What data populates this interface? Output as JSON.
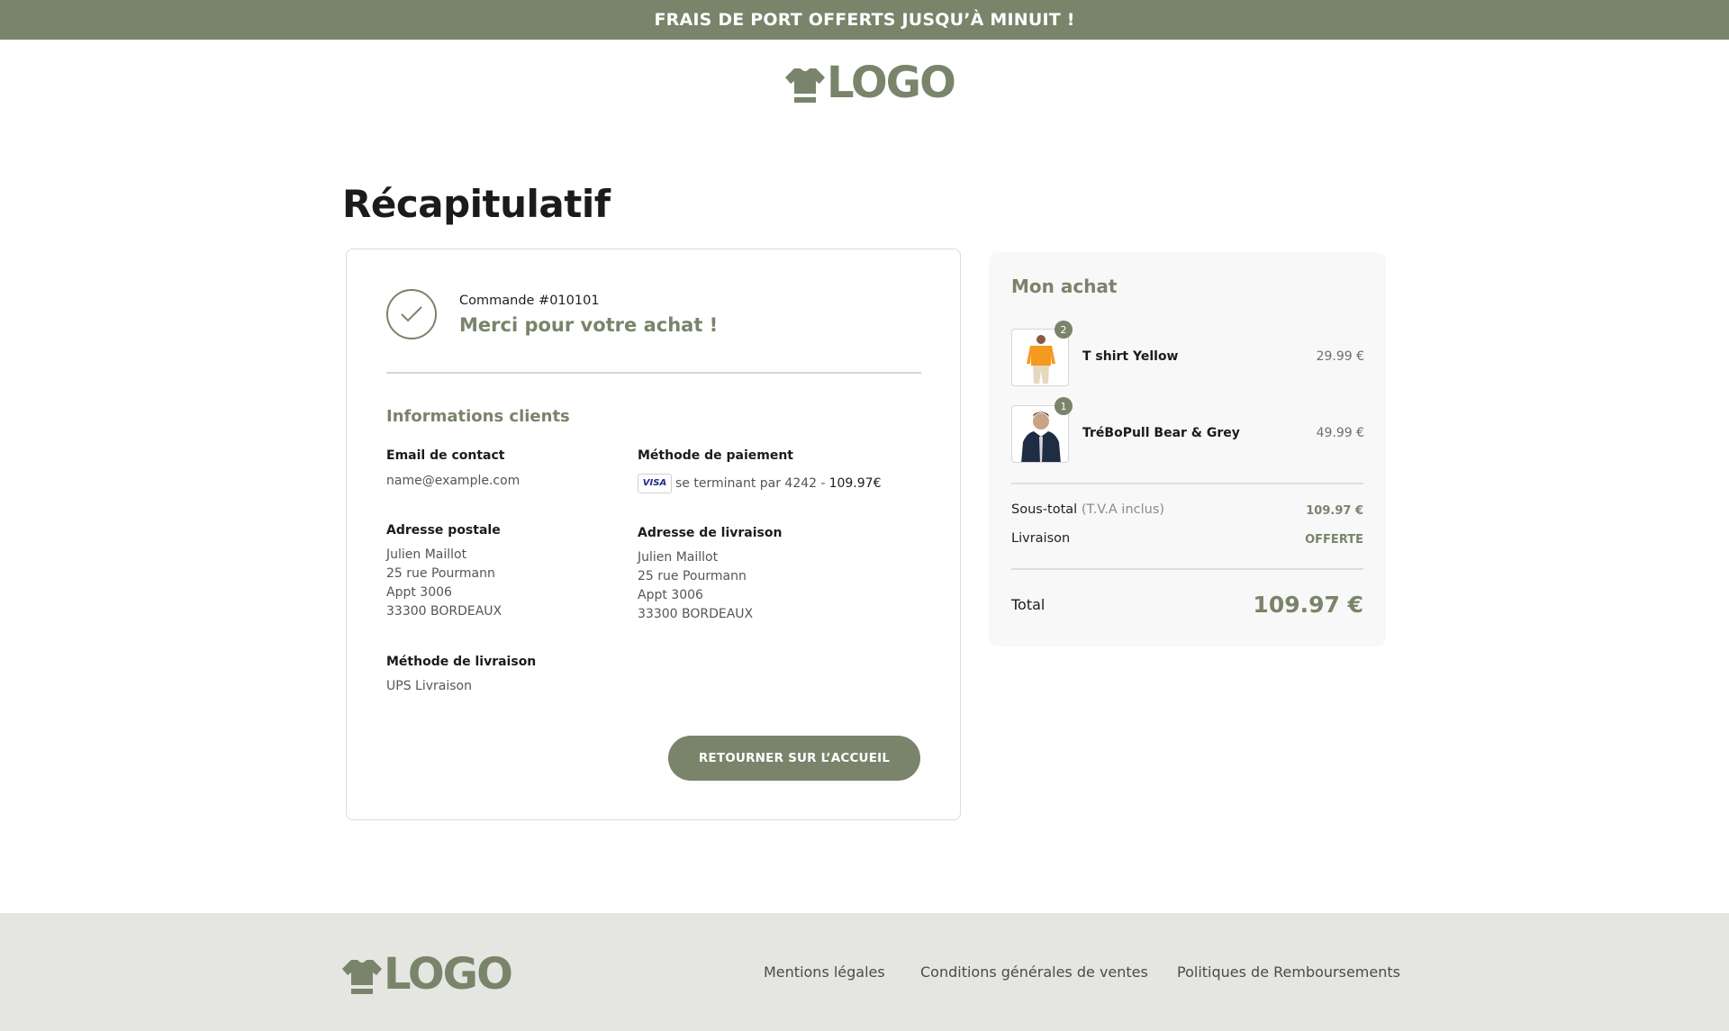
{
  "banner": {
    "text": "FRAIS DE PORT OFFERTS JUSQU’À MINUIT !"
  },
  "header": {
    "logo_text": "LOGO"
  },
  "page": {
    "title": "Récapitulatif"
  },
  "confirmation": {
    "order_number": "Commande #010101",
    "thank_you": "Merci pour votre achat !"
  },
  "customer": {
    "section_title": "Informations clients",
    "email_label": "Email de contact",
    "email": "name@example.com",
    "payment_label": "Méthode de paiement",
    "payment_card_brand": "VISA",
    "payment_text": "se terminant par 4242 -",
    "payment_amount": "109.97€",
    "postal_label": "Adresse postale",
    "postal_lines": [
      "Julien Maillot",
      "25 rue Pourmann",
      "Appt 3006",
      "33300 BORDEAUX"
    ],
    "delivery_address_label": "Adresse de livraison",
    "delivery_lines": [
      "Julien Maillot",
      "25 rue Pourmann",
      "Appt 3006",
      "33300 BORDEAUX"
    ],
    "shipping_method_label": "Méthode de livraison",
    "shipping_method": "UPS Livraison"
  },
  "actions": {
    "home_button": "RETOURNER SUR L’ACCUEIL"
  },
  "summary": {
    "title": "Mon achat",
    "items": [
      {
        "name": "T shirt Yellow",
        "price": "29.99 €",
        "quantity": "2"
      },
      {
        "name": "TréBoPull Bear & Grey",
        "price": "49.99 €",
        "quantity": "1"
      }
    ],
    "subtotal_label": "Sous-total",
    "subtotal_note": "(T.V.A inclus)",
    "subtotal_value": "109.97 €",
    "shipping_label": "Livraison",
    "shipping_value": "OFFERTE",
    "total_label": "Total",
    "total_value": "109.97 €"
  },
  "footer": {
    "logo_text": "LOGO",
    "links": [
      "Mentions légales",
      "Conditions générales de ventes",
      "Politiques de Remboursements"
    ]
  },
  "colors": {
    "accent": "#79846a",
    "footer_bg": "#e5e6e1",
    "summary_bg": "#f8f8f8"
  }
}
